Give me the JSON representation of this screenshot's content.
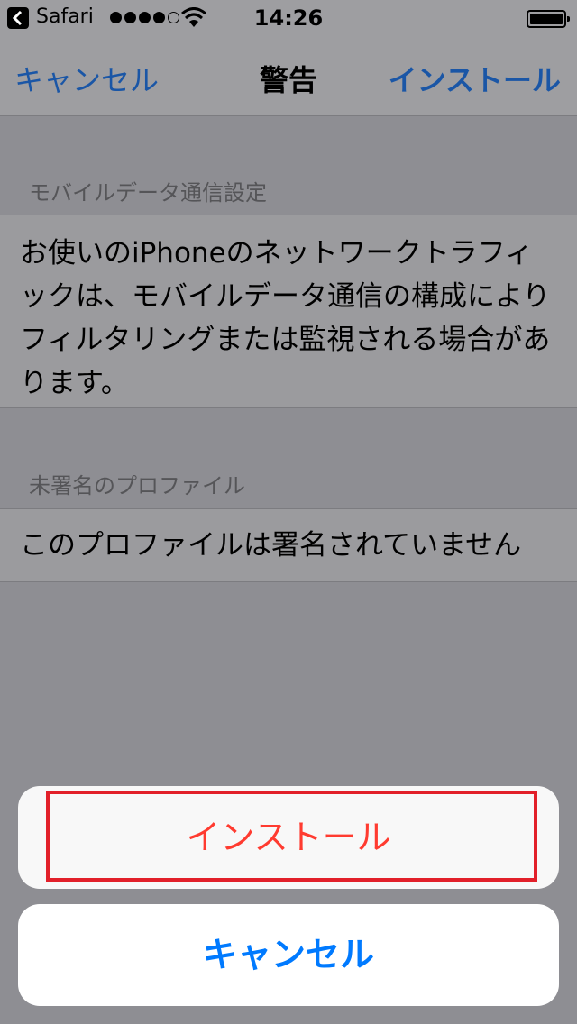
{
  "status_bar": {
    "carrier": "Safari",
    "time": "14:26",
    "signal_bars_filled": 4,
    "signal_bars_total": 5
  },
  "nav": {
    "cancel": "キャンセル",
    "title": "警告",
    "install": "インストール"
  },
  "sections": [
    {
      "header": "モバイルデータ通信設定",
      "body": "お使いのiPhoneのネットワークトラフィックは、モバイルデータ通信の構成によりフィルタリングまたは監視される場合があります。"
    },
    {
      "header": "未署名のプロファイル",
      "body": "このプロファイルは署名されていません"
    }
  ],
  "action_sheet": {
    "install": "インストール",
    "cancel": "キャンセル"
  },
  "colors": {
    "link_blue": "#1a56a6",
    "destructive_red": "#ff3b30",
    "cancel_blue": "#007aff",
    "highlight_red": "#e2202a"
  }
}
